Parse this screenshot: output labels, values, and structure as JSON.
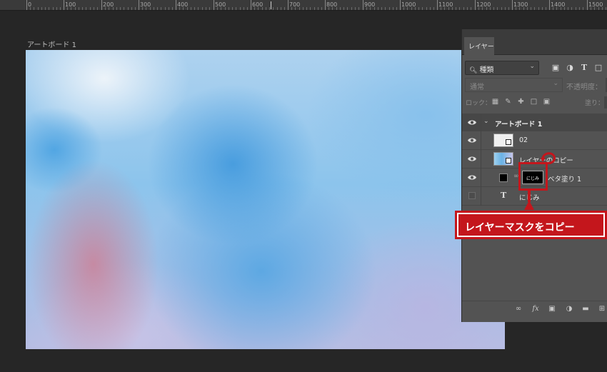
{
  "ruler": {
    "labels": [
      "0",
      "100",
      "200",
      "300",
      "400",
      "500",
      "600",
      "700",
      "800",
      "900",
      "1000",
      "1100",
      "1200",
      "1300",
      "1400",
      "1500"
    ]
  },
  "artboard": {
    "label": "アートボード 1"
  },
  "layers_panel": {
    "tab_label": "レイヤー",
    "filter_kind": "種類",
    "blend_mode": "通常",
    "opacity_label": "不透明度：",
    "lock_label": "ロック：",
    "fill_label": "塗り：",
    "layers": [
      {
        "name": "アートボード 1",
        "visible": true,
        "type": "artboard-group"
      },
      {
        "name": "02",
        "visible": true,
        "type": "smart-object"
      },
      {
        "name": "レイヤーのコピー",
        "visible": true,
        "type": "smart-object"
      },
      {
        "name": "ベタ塗り 1",
        "visible": true,
        "type": "fill-with-mask"
      },
      {
        "name": "にじみ",
        "visible": false,
        "type": "text"
      }
    ],
    "mask_thumbnail_text": "にじみ"
  },
  "annotation": {
    "callout_text": "レイヤーマスクをコピー",
    "color": "#c4161c"
  },
  "icons": {
    "filter": [
      "image-filter-icon",
      "adjustment-filter-icon",
      "text-filter-icon",
      "shape-filter-icon"
    ],
    "lock": [
      "lock-transparent-icon",
      "lock-paint-icon",
      "lock-position-icon",
      "lock-artboard-icon",
      "lock-all-icon"
    ],
    "bottom": [
      "link-layers-icon",
      "fx-icon",
      "add-mask-icon",
      "new-adjustment-icon",
      "new-group-icon",
      "new-layer-icon"
    ]
  }
}
